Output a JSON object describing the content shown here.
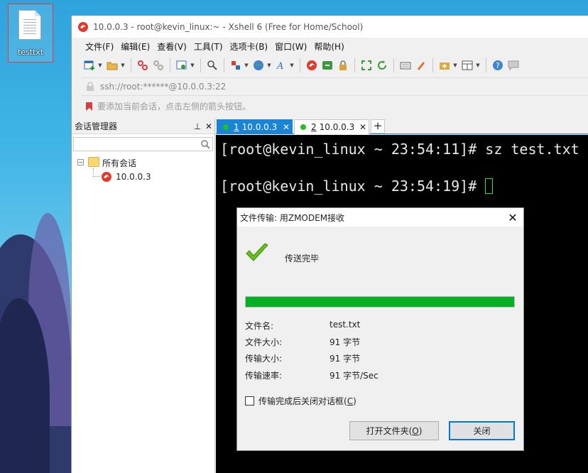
{
  "desktop": {
    "icon_label": "testtxt"
  },
  "window": {
    "title": "10.0.0.3 - root@kevin_linux:~ - Xshell 6 (Free for Home/School)",
    "app_icon": "xshell-icon"
  },
  "menu": {
    "items": [
      "文件(F)",
      "编辑(E)",
      "查看(V)",
      "工具(T)",
      "选项卡(B)",
      "窗口(W)",
      "帮助(H)"
    ]
  },
  "toolbar": {
    "icons": [
      "new-session-icon",
      "open-folder-icon",
      "connect-icon",
      "disconnect-icon",
      "properties-icon",
      "find-icon",
      "transfer-icon",
      "globe-icon",
      "font-icon",
      "xshell-icon",
      "xftp-icon",
      "lock-icon",
      "fullscreen-icon",
      "refresh-icon",
      "keyboard-icon",
      "highlight-icon",
      "script-icon",
      "layout-icon",
      "help-icon",
      "chat-icon"
    ]
  },
  "address": {
    "value": "ssh://root:******@10.0.0.3:22"
  },
  "hint": {
    "text": "要添加当前会话，点击左侧的箭头按钮。"
  },
  "session_manager": {
    "title": "会话管理器",
    "pin_label": "ㅂ",
    "close_label": "✕",
    "root_label": "所有会话",
    "host_label": "10.0.0.3"
  },
  "tabs": [
    {
      "num": "1",
      "label": "10.0.0.3",
      "active": true
    },
    {
      "num": "2",
      "label": "10.0.0.3",
      "active": false
    }
  ],
  "tab_close": "✕",
  "tab_add": "+",
  "terminal": {
    "line1": "[root@kevin_linux ~ 23:54:11]# sz test.txt",
    "line2": "[root@kevin_linux ~ 23:54:19]# "
  },
  "dialog": {
    "title": "文件传输: 用ZMODEM接收",
    "close": "✕",
    "status": "传送完毕",
    "progress": 1.0,
    "fields": [
      {
        "label": "文件名:",
        "value": "test.txt"
      },
      {
        "label": "文件大小:",
        "value": "91 字节"
      },
      {
        "label": "传输大小:",
        "value": "91 字节"
      },
      {
        "label": "传输速率:",
        "value": "91 字节/Sec"
      }
    ],
    "checkbox_label": "传输完成后关闭对话框",
    "checkbox_accel": "C",
    "checkbox_checked": false,
    "open_folder_button": "打开文件夹",
    "open_folder_accel": "O",
    "close_button": "关闭"
  },
  "colors": {
    "accent": "#1a84d6",
    "progress": "#06b025",
    "terminal_bg": "#000000",
    "session_dot": "#1fc01f"
  }
}
